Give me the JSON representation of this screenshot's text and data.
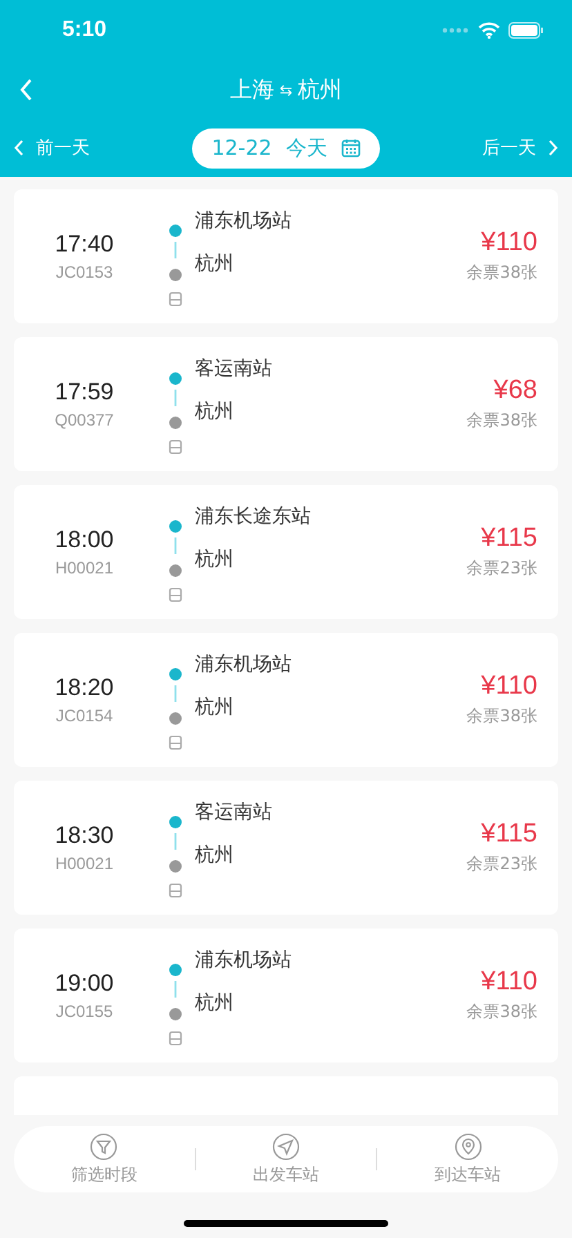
{
  "status_bar": {
    "time": "5:10"
  },
  "nav": {
    "from": "上海",
    "swap": "⇆",
    "to": "杭州"
  },
  "date_bar": {
    "prev": "前一天",
    "date": "12-22",
    "day": "今天",
    "next": "后一天"
  },
  "trips": [
    {
      "time": "17:40",
      "code": "JC0153",
      "from": "浦东机场站",
      "to": "杭州",
      "price": "¥110",
      "remaining": "余票38张"
    },
    {
      "time": "17:59",
      "code": "Q00377",
      "from": "客运南站",
      "to": "杭州",
      "price": "¥68",
      "remaining": "余票38张"
    },
    {
      "time": "18:00",
      "code": "H00021",
      "from": "浦东长途东站",
      "to": "杭州",
      "price": "¥115",
      "remaining": "余票23张"
    },
    {
      "time": "18:20",
      "code": "JC0154",
      "from": "浦东机场站",
      "to": "杭州",
      "price": "¥110",
      "remaining": "余票38张"
    },
    {
      "time": "18:30",
      "code": "H00021",
      "from": "客运南站",
      "to": "杭州",
      "price": "¥115",
      "remaining": "余票23张"
    },
    {
      "time": "19:00",
      "code": "JC0155",
      "from": "浦东机场站",
      "to": "杭州",
      "price": "¥110",
      "remaining": "余票38张"
    }
  ],
  "bottom_bar": [
    {
      "kind": "filter",
      "label": "筛选时段"
    },
    {
      "kind": "depart",
      "label": "出发车站"
    },
    {
      "kind": "arrive",
      "label": "到达车站"
    }
  ]
}
